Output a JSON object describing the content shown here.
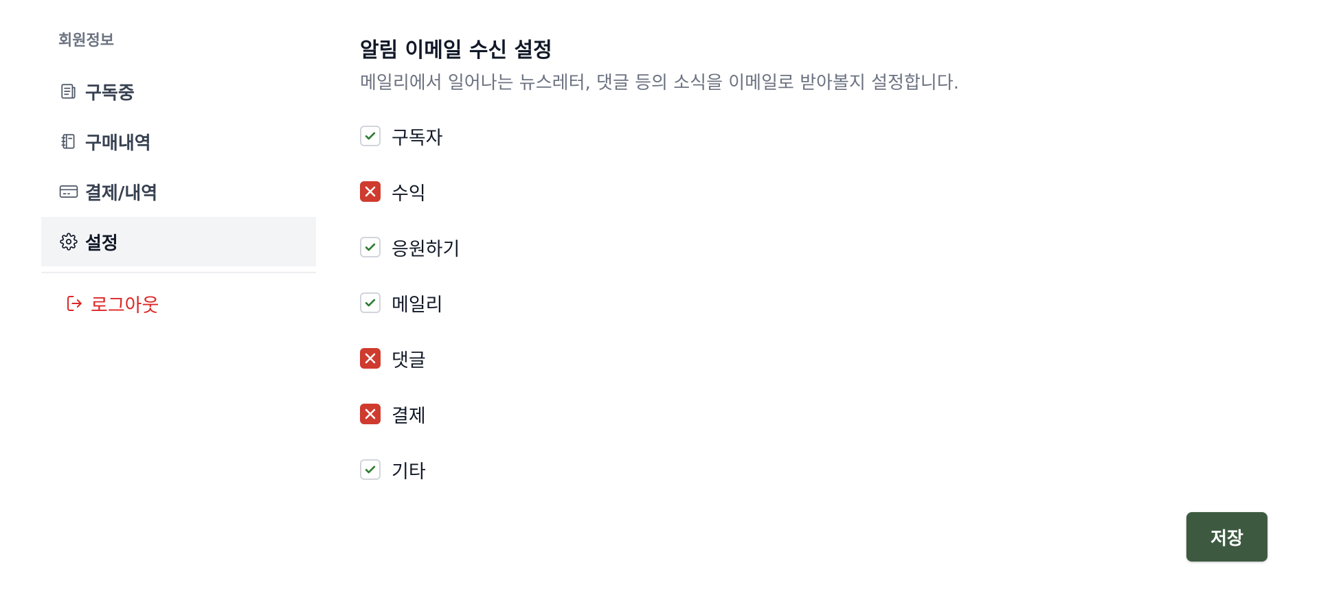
{
  "sidebar": {
    "heading": "회원정보",
    "items": [
      {
        "label": "구독중",
        "icon": "document-list-icon",
        "active": false
      },
      {
        "label": "구매내역",
        "icon": "notebook-icon",
        "active": false
      },
      {
        "label": "결제/내역",
        "icon": "credit-card-icon",
        "active": false
      },
      {
        "label": "설정",
        "icon": "gear-icon",
        "active": true
      }
    ],
    "logout": {
      "label": "로그아웃",
      "icon": "logout-icon"
    }
  },
  "main": {
    "title": "알림 이메일 수신 설정",
    "subtitle": "메일리에서 일어나는 뉴스레터, 댓글 등의 소식을 이메일로 받아볼지 설정합니다.",
    "options": [
      {
        "label": "구독자",
        "checked": true
      },
      {
        "label": "수익",
        "checked": false
      },
      {
        "label": "응원하기",
        "checked": true
      },
      {
        "label": "메일리",
        "checked": true
      },
      {
        "label": "댓글",
        "checked": false
      },
      {
        "label": "결제",
        "checked": false
      },
      {
        "label": "기타",
        "checked": true
      }
    ],
    "save_label": "저장"
  },
  "colors": {
    "accent": "#3d5a40",
    "danger": "#dc2626",
    "check_green": "#2e7d32",
    "unchecked_red": "#cf3b2f",
    "active_bg": "#f3f4f6"
  }
}
